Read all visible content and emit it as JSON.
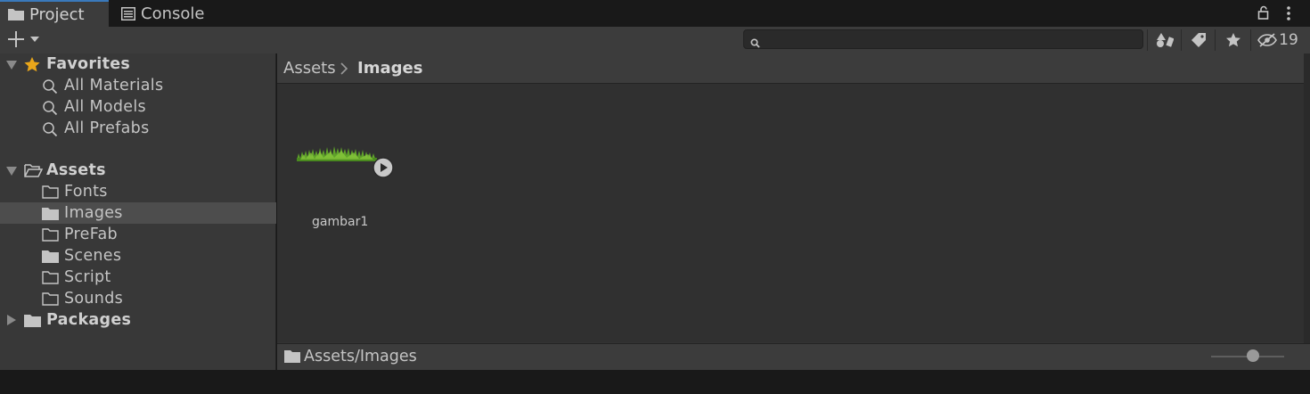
{
  "tabs": [
    {
      "label": "Project",
      "icon": "folder-icon",
      "active": true
    },
    {
      "label": "Console",
      "icon": "console-icon",
      "active": false
    }
  ],
  "toolbar": {
    "search_value": "",
    "hidden_count": "19"
  },
  "sidebar": {
    "favorites": {
      "label": "Favorites",
      "items": [
        "All Materials",
        "All Models",
        "All Prefabs"
      ]
    },
    "assets": {
      "label": "Assets",
      "items": [
        "Fonts",
        "Images",
        "PreFab",
        "Scenes",
        "Script",
        "Sounds"
      ],
      "selected": "Images"
    },
    "packages": {
      "label": "Packages"
    }
  },
  "breadcrumb": [
    "Assets",
    "Images"
  ],
  "assets": [
    {
      "name": "gambar1",
      "type": "animated-sprite"
    }
  ],
  "status": {
    "path": "Assets/Images",
    "thumbnail_size": 0.55
  },
  "colors": {
    "accent": "#3a79bb",
    "favorite_star": "#e9a61a",
    "selected_row": "#4d4d4d"
  }
}
